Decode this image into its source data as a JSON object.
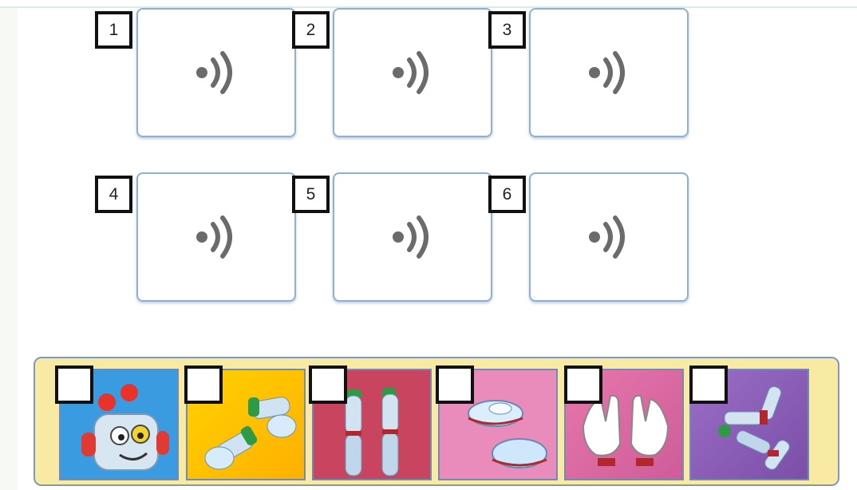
{
  "audio_items": [
    {
      "number": "1",
      "icon": "speaker-icon"
    },
    {
      "number": "2",
      "icon": "speaker-icon"
    },
    {
      "number": "3",
      "icon": "speaker-icon"
    },
    {
      "number": "4",
      "icon": "speaker-icon"
    },
    {
      "number": "5",
      "icon": "speaker-icon"
    },
    {
      "number": "6",
      "icon": "speaker-icon"
    }
  ],
  "pictures": [
    {
      "subject": "robot-head",
      "background": "#3a9be0"
    },
    {
      "subject": "robot-arms",
      "background": "#f6d33a"
    },
    {
      "subject": "robot-legs",
      "background": "#c9445e"
    },
    {
      "subject": "robot-feet",
      "background": "#e98cbc"
    },
    {
      "subject": "robot-hands",
      "background": "#d76aa2"
    },
    {
      "subject": "robot-body-parts",
      "background": "#8a5fb8"
    }
  ],
  "answer_boxes": [
    "",
    "",
    "",
    "",
    "",
    ""
  ],
  "colors": {
    "card_border": "#8fb0d6",
    "tray": "#f8eaa2",
    "speaker": "#6b6b6b"
  }
}
